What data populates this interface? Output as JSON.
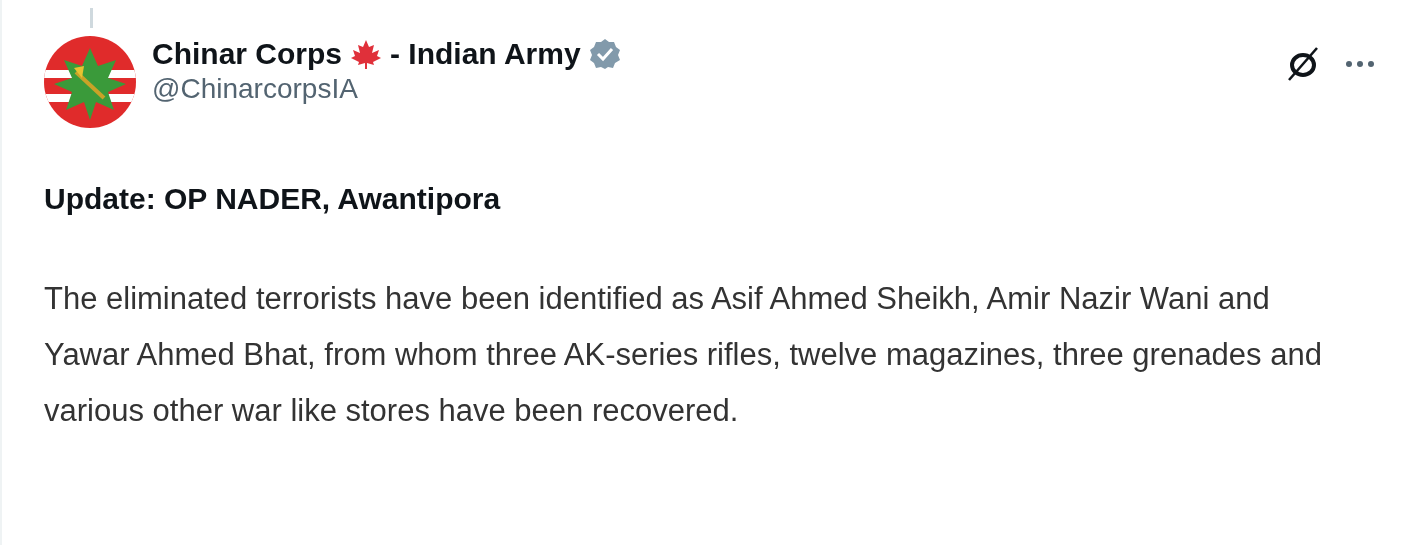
{
  "post": {
    "author": {
      "name_before_flag": "Chinar Corps",
      "name_after_flag": "- Indian Army",
      "verified": true,
      "handle": "@ChinarcorpsIA"
    },
    "headline": "Update: OP NADER, Awantipora",
    "body": "The eliminated terrorists have been identified as Asif Ahmed Sheikh, Amir Nazir Wani and Yawar Ahmed Bhat, from whom three AK-series rifles, twelve magazines, three grenades and various other war like stores have been recovered."
  }
}
